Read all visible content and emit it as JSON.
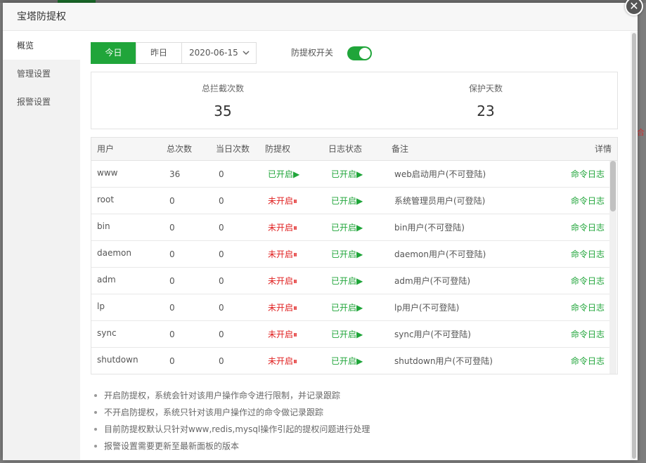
{
  "modal": {
    "title": "宝塔防提权",
    "close_glyph": "✕"
  },
  "sidebar": {
    "items": [
      {
        "label": "概览"
      },
      {
        "label": "管理设置"
      },
      {
        "label": "报警设置"
      }
    ]
  },
  "filters": {
    "today": "今日",
    "yesterday": "昨日",
    "date": "2020-06-15",
    "switch_label": "防提权开关",
    "switch_on": true
  },
  "stats": {
    "blocked_label": "总拦截次数",
    "blocked_value": "35",
    "days_label": "保护天数",
    "days_value": "23"
  },
  "table": {
    "headers": {
      "user": "用户",
      "total": "总次数",
      "today": "当日次数",
      "protect": "防提权",
      "log": "日志状态",
      "note": "备注",
      "detail": "详情"
    },
    "rows": [
      {
        "user": "www",
        "total": "36",
        "today": "0",
        "protect": "已开启▶",
        "protect_on": true,
        "log": "已开启▶",
        "note": "web启动用户(不可登陆)",
        "detail": "命令日志"
      },
      {
        "user": "root",
        "total": "0",
        "today": "0",
        "protect": "未开启⏸",
        "protect_on": false,
        "log": "已开启▶",
        "note": "系统管理员用户(可登陆)",
        "detail": "命令日志"
      },
      {
        "user": "bin",
        "total": "0",
        "today": "0",
        "protect": "未开启⏸",
        "protect_on": false,
        "log": "已开启▶",
        "note": "bin用户(不可登陆)",
        "detail": "命令日志"
      },
      {
        "user": "daemon",
        "total": "0",
        "today": "0",
        "protect": "未开启⏸",
        "protect_on": false,
        "log": "已开启▶",
        "note": "daemon用户(不可登陆)",
        "detail": "命令日志"
      },
      {
        "user": "adm",
        "total": "0",
        "today": "0",
        "protect": "未开启⏸",
        "protect_on": false,
        "log": "已开启▶",
        "note": "adm用户(不可登陆)",
        "detail": "命令日志"
      },
      {
        "user": "lp",
        "total": "0",
        "today": "0",
        "protect": "未开启⏸",
        "protect_on": false,
        "log": "已开启▶",
        "note": "lp用户(不可登陆)",
        "detail": "命令日志"
      },
      {
        "user": "sync",
        "total": "0",
        "today": "0",
        "protect": "未开启⏸",
        "protect_on": false,
        "log": "已开启▶",
        "note": "sync用户(不可登陆)",
        "detail": "命令日志"
      },
      {
        "user": "shutdown",
        "total": "0",
        "today": "0",
        "protect": "未开启⏸",
        "protect_on": false,
        "log": "已开启▶",
        "note": "shutdown用户(不可登陆)",
        "detail": "命令日志"
      }
    ]
  },
  "notes": [
    "开启防提权，系统会针对该用户操作命令进行限制，并记录跟踪",
    "不开启防提权，系统只针对该用户操作过的命令做记录跟踪",
    "目前防提权默认只针对www,redis,mysql操作引起的提权问题进行处理",
    "报警设置需要更新至最新面板的版本"
  ],
  "background": {
    "edge_text": "合"
  },
  "colors": {
    "accent": "#20a53a",
    "danger": "#e02020"
  }
}
